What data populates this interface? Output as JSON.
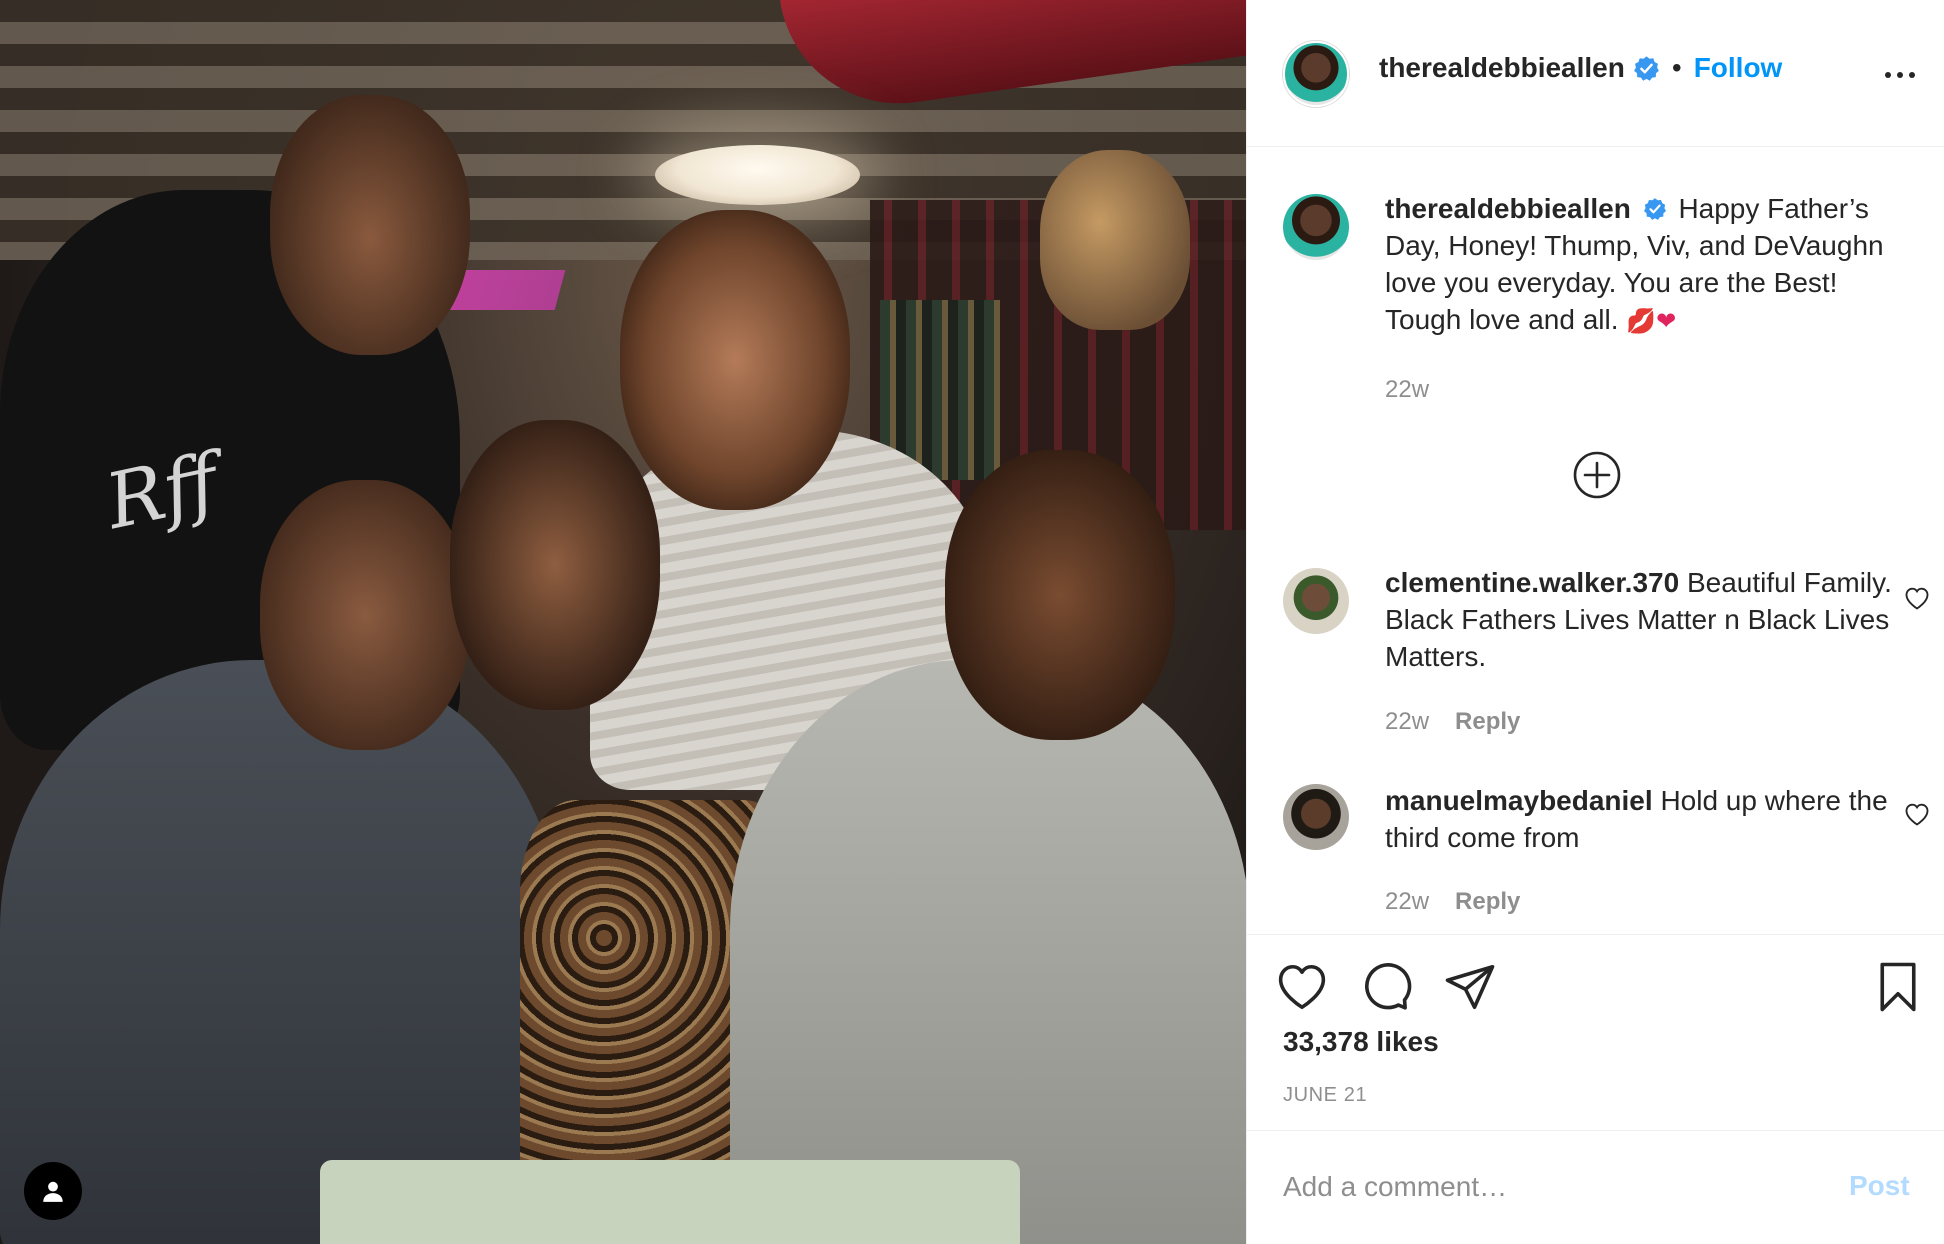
{
  "post": {
    "author": "therealdebbieallen",
    "follow_label": "Follow",
    "separator": "•",
    "caption": {
      "username": "therealdebbieallen",
      "text": "Happy Father’s Day, Honey! Thump, Viv, and DeVaughn love you everyday. You are the Best! Tough love and all.",
      "emojis": "💋❤",
      "time": "22w"
    },
    "comments": [
      {
        "username": "clementine.walker.370",
        "text": "Beautiful Family. Black Fathers Lives Matter n Black Lives Matters.",
        "time": "22w",
        "reply_label": "Reply"
      },
      {
        "username": "manuelmaybedaniel",
        "text": "Hold up where the third come from",
        "time": "22w",
        "reply_label": "Reply"
      }
    ],
    "likes": "33,378 likes",
    "date": "JUNE 21",
    "add_comment_placeholder": "Add a comment…",
    "post_label": "Post",
    "photo_logo_text": "Rff"
  },
  "icons": {
    "verified": "verified-badge-icon",
    "more": "more-options-icon",
    "load_more": "plus-circle-icon",
    "like": "heart-icon",
    "comment": "comment-bubble-icon",
    "share": "paper-plane-icon",
    "save": "bookmark-icon",
    "tag": "user-tag-icon"
  },
  "colors": {
    "link_blue": "#0095f6",
    "verified_blue": "#3897f0",
    "muted_text": "#8e8e8e",
    "post_disabled": "#b3dbff",
    "border": "#efefef"
  }
}
